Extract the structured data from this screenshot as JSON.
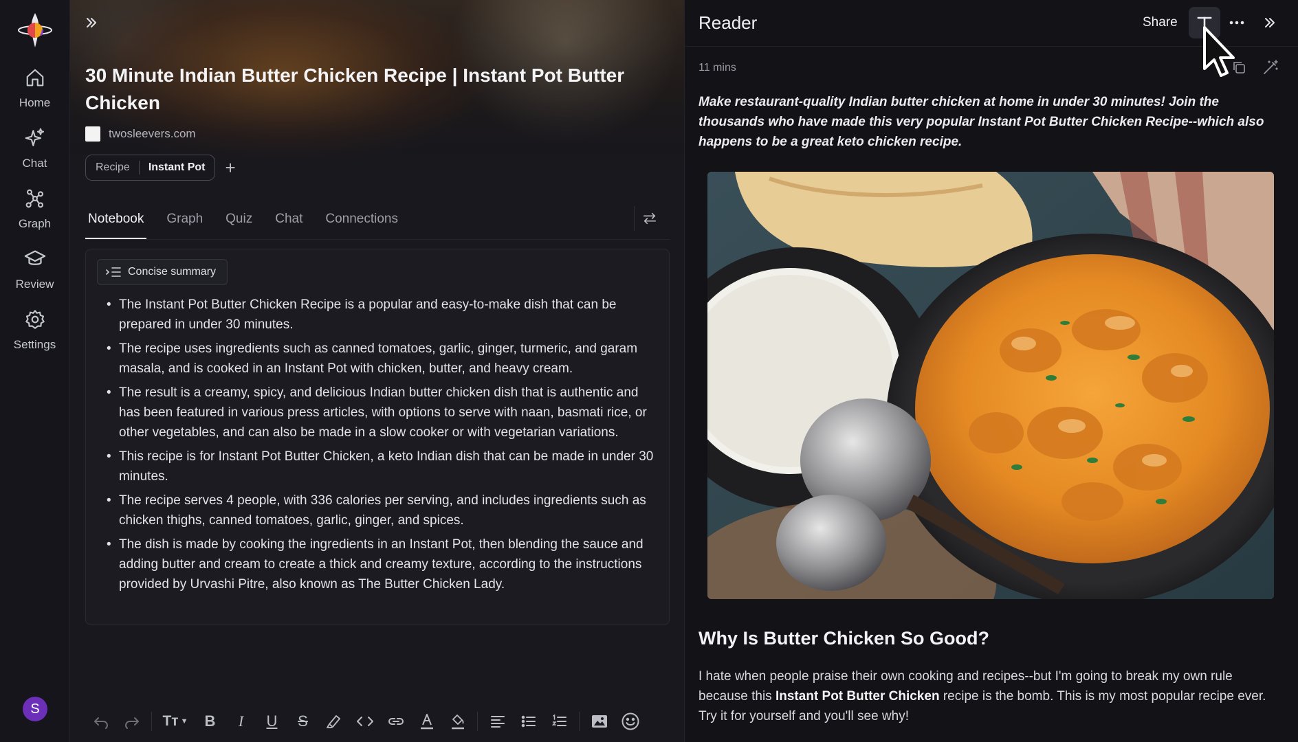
{
  "sidebar": {
    "items": [
      {
        "label": "Home",
        "icon": "home-icon"
      },
      {
        "label": "Chat",
        "icon": "sparkle-icon"
      },
      {
        "label": "Graph",
        "icon": "graph-icon"
      },
      {
        "label": "Review",
        "icon": "graduation-cap-icon"
      },
      {
        "label": "Settings",
        "icon": "gear-icon"
      }
    ],
    "avatar_initial": "S"
  },
  "document": {
    "title": "30 Minute Indian Butter Chicken Recipe | Instant Pot Butter Chicken",
    "source": "twosleevers.com",
    "tags": [
      "Recipe",
      "Instant Pot"
    ],
    "add_tag": "+"
  },
  "tabs": [
    "Notebook",
    "Graph",
    "Quiz",
    "Chat",
    "Connections"
  ],
  "summary": {
    "chip_label": "Concise summary",
    "bullets": [
      "The Instant Pot Butter Chicken Recipe is a popular and easy-to-make dish that can be prepared in under 30 minutes.",
      "The recipe uses ingredients such as canned tomatoes, garlic, ginger, turmeric, and garam masala, and is cooked in an Instant Pot with chicken, butter, and heavy cream.",
      "The result is a creamy, spicy, and delicious Indian butter chicken dish that is authentic and has been featured in various press articles, with options to serve with naan, basmati rice, or other vegetables, and can also be made in a slow cooker or with vegetarian variations.",
      "This recipe is for Instant Pot Butter Chicken, a keto Indian dish that can be made in under 30 minutes.",
      "The recipe serves 4 people, with 336 calories per serving, and includes ingredients such as chicken thighs, canned tomatoes, garlic, ginger, and spices.",
      "The dish is made by cooking the ingredients in an Instant Pot, then blending the sauce and adding butter and cream to create a thick and creamy texture, according to the instructions provided by Urvashi Pitre, also known as The Butter Chicken Lady."
    ]
  },
  "toolbar": {
    "text_style": "Tт"
  },
  "reader": {
    "title": "Reader",
    "share": "Share",
    "read_time": "11 mins",
    "lead": "Make restaurant-quality Indian butter chicken at home in under 30 minutes! Join the thousands who have made this very popular Instant Pot Butter Chicken Recipe--which also happens to be a great keto chicken recipe.",
    "heading": "Why Is Butter Chicken So Good?",
    "body_before": "I hate when people praise their own cooking and recipes--but I'm going to break my own rule because this ",
    "body_bold": "Instant Pot Butter Chicken",
    "body_after": " recipe is the bomb. This is my most popular recipe ever. Try it for yourself and you'll see why!"
  },
  "colors": {
    "background": "#141419",
    "panel": "#18181e",
    "accent_avatar": "#6b2fb8",
    "text": "#e8e8ec"
  }
}
